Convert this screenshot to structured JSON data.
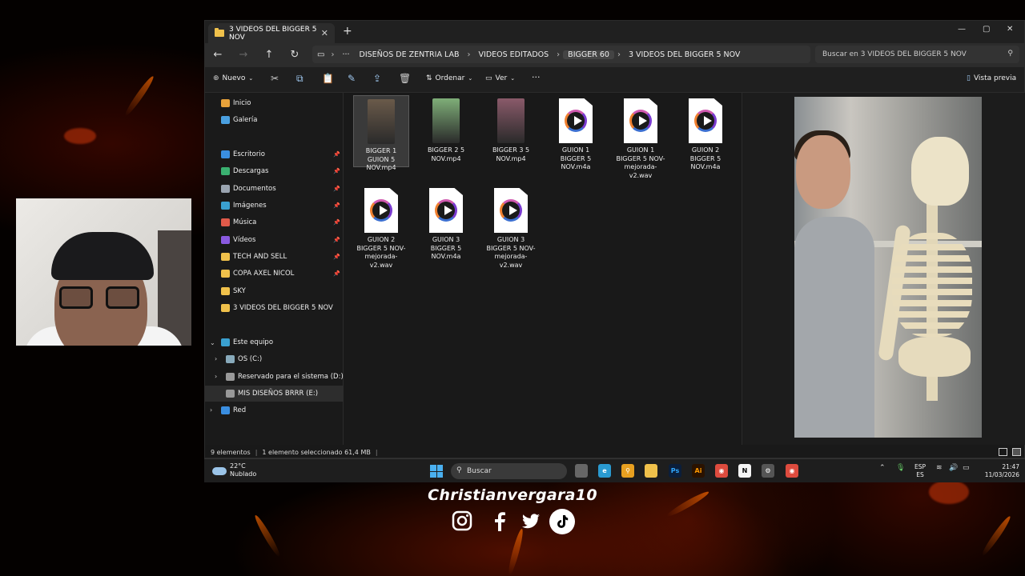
{
  "window": {
    "tab_title": "3 VIDEOS DEL BIGGER 5 NOV",
    "tab_close": "✕",
    "new_tab": "+",
    "min": "—",
    "max": "▢",
    "close": "✕"
  },
  "nav": {
    "back": "←",
    "forward": "→",
    "up": "↑",
    "refresh": "↻",
    "more": "···"
  },
  "breadcrumb": [
    "DISEÑOS DE ZENTRIA LAB",
    "VIDEOS EDITADOS",
    "BIGGER 60",
    "3 VIDEOS DEL BIGGER 5 NOV"
  ],
  "search": {
    "placeholder": "Buscar en 3 VIDEOS DEL BIGGER 5 NOV"
  },
  "toolbar": {
    "new_label": "Nuevo",
    "sort_label": "Ordenar",
    "view_label": "Ver",
    "more": "···",
    "preview_label": "Vista previa"
  },
  "sidebar": {
    "quick": [
      {
        "label": "Inicio",
        "color": "#e8a23a",
        "pinned": false
      },
      {
        "label": "Galería",
        "color": "#4aa0e0",
        "pinned": false
      },
      {
        "label": "Escritorio",
        "color": "#3a8ee0",
        "pinned": true
      },
      {
        "label": "Descargas",
        "color": "#3ab070",
        "pinned": true
      },
      {
        "label": "Documentos",
        "color": "#9aa4b0",
        "pinned": true
      },
      {
        "label": "Imágenes",
        "color": "#3aa0d0",
        "pinned": true
      },
      {
        "label": "Música",
        "color": "#e05a4a",
        "pinned": true
      },
      {
        "label": "Vídeos",
        "color": "#8a5ae0",
        "pinned": true
      },
      {
        "label": "TECH AND SELL",
        "color": "#f0c14b",
        "pinned": true
      },
      {
        "label": "COPA AXEL NICOL",
        "color": "#f0c14b",
        "pinned": true
      },
      {
        "label": "SKY",
        "color": "#f0c14b",
        "pinned": false
      },
      {
        "label": "3 VIDEOS DEL BIGGER 5 NOV",
        "color": "#f0c14b",
        "pinned": false
      }
    ],
    "pc_label": "Este equipo",
    "drives": [
      "OS (C:)",
      "Reservado para el sistema (D:)",
      "MIS DISEÑOS BRRR (E:)"
    ],
    "network_label": "Red",
    "pin_glyph": "📌"
  },
  "files": [
    {
      "name": "BIGGER 1 GUION 5 NOV.mp4",
      "kind": "video",
      "thumb": "#6a5a4a",
      "selected": true
    },
    {
      "name": "BIGGER 2 5 NOV.mp4",
      "kind": "video",
      "thumb": "#7fae78",
      "selected": false
    },
    {
      "name": "BIGGER 3 5 NOV.mp4",
      "kind": "video",
      "thumb": "#8a5a6a",
      "selected": false
    },
    {
      "name": "GUION 1 BIGGER 5 NOV.m4a",
      "kind": "audio",
      "selected": false
    },
    {
      "name": "GUION 1 BIGGER 5 NOV-mejorada-v2.wav",
      "kind": "audio",
      "selected": false
    },
    {
      "name": "GUION 2 BIGGER 5 NOV.m4a",
      "kind": "audio",
      "selected": false
    },
    {
      "name": "GUION 2 BIGGER 5 NOV-mejorada-v2.wav",
      "kind": "audio",
      "selected": false
    },
    {
      "name": "GUION 3 BIGGER 5 NOV.m4a",
      "kind": "audio",
      "selected": false
    },
    {
      "name": "GUION 3 BIGGER 5 NOV-mejorada-v2.wav",
      "kind": "audio",
      "selected": false
    }
  ],
  "status": {
    "count": "9 elementos",
    "selection": "1 elemento seleccionado  61,4 MB"
  },
  "taskbar": {
    "temp": "22°C",
    "weather": "Nublado",
    "search": "Buscar",
    "lang1": "ESP",
    "lang2": "ES",
    "time": "21:47",
    "date": "11/03/2026",
    "apps": [
      {
        "name": "task-view",
        "color": "#666",
        "glyph": ""
      },
      {
        "name": "edge",
        "color": "#2a9ad0",
        "glyph": "e"
      },
      {
        "name": "search-app",
        "color": "#e8a020",
        "glyph": "⚲"
      },
      {
        "name": "file-explorer",
        "color": "#f0c14b",
        "glyph": ""
      },
      {
        "name": "photoshop",
        "color": "#0b1e3a",
        "glyph": "Ps"
      },
      {
        "name": "illustrator",
        "color": "#2a1200",
        "glyph": "Ai"
      },
      {
        "name": "chrome",
        "color": "#dd4b3e",
        "glyph": "◉"
      },
      {
        "name": "notion",
        "color": "#f4f4f4",
        "glyph": "N"
      },
      {
        "name": "chatgpt",
        "color": "#555",
        "glyph": "⚙"
      },
      {
        "name": "chrome-2",
        "color": "#dd4b3e",
        "glyph": "◉"
      }
    ]
  },
  "overlay": {
    "handle": "Christianvergara10",
    "socials": [
      "instagram",
      "facebook",
      "twitter",
      "tiktok"
    ]
  }
}
